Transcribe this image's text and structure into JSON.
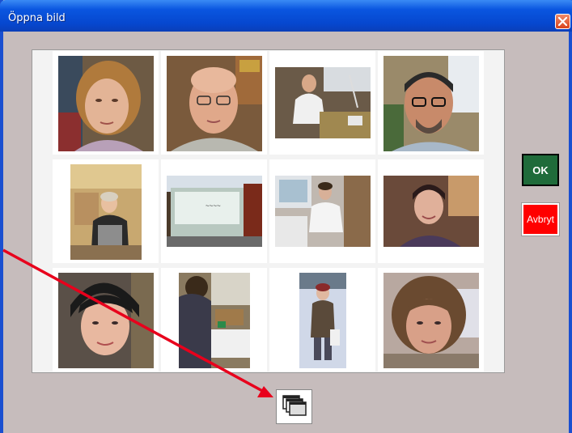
{
  "window": {
    "title": "Öppna bild"
  },
  "buttons": {
    "ok_label": "OK",
    "cancel_label": "Avbryt"
  },
  "icons": {
    "close": "close-icon",
    "browse": "overlapping-windows-icon"
  },
  "colors": {
    "title_bar": "#0a56e0",
    "window_bg": "#c6bcbc",
    "ok": "#1f6b3a",
    "cancel": "#ff0000",
    "arrow": "#e8001c"
  },
  "photos": [
    {
      "id": "photo-1"
    },
    {
      "id": "photo-2"
    },
    {
      "id": "photo-3"
    },
    {
      "id": "photo-4"
    },
    {
      "id": "photo-5"
    },
    {
      "id": "photo-6"
    },
    {
      "id": "photo-7"
    },
    {
      "id": "photo-8"
    },
    {
      "id": "photo-9"
    },
    {
      "id": "photo-10"
    },
    {
      "id": "photo-11"
    },
    {
      "id": "photo-12"
    }
  ]
}
